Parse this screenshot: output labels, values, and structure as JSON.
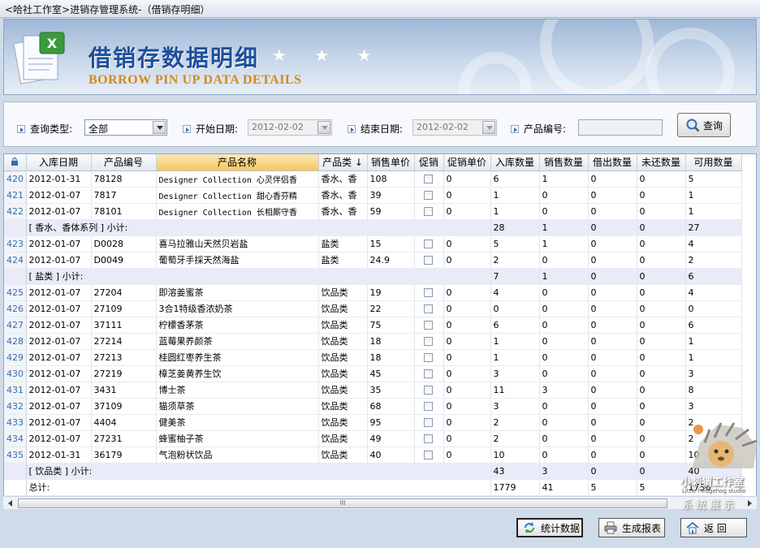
{
  "window": {
    "title": "<哈社工作室>进销存管理系统-（借销存明细）"
  },
  "banner": {
    "title_cn": "借销存数据明细",
    "stars": "★ ★ ★",
    "title_en": "BORROW PIN UP DATA DETAILS"
  },
  "filters": {
    "query_type_label": "查询类型:",
    "query_type_value": "全部",
    "start_date_label": "开始日期:",
    "start_date_value": "2012-02-02",
    "end_date_label": "结束日期:",
    "end_date_value": "2012-02-02",
    "product_code_label": "产品编号:",
    "product_code_value": "",
    "query_button": "查询"
  },
  "table": {
    "columns": [
      "入库日期",
      "产品编号",
      "产品名称",
      "产品类 ↓",
      "销售单价",
      "促销",
      "促销单价",
      "入库数量",
      "销售数量",
      "借出数量",
      "未还数量",
      "可用数量"
    ],
    "rows": [
      {
        "type": "data",
        "n": "420",
        "date": "2012-01-31",
        "code": "78128",
        "name": "Designer Collection 心灵伴侣香",
        "cat": "香水、香",
        "price": "108",
        "pp": "0",
        "in": "6",
        "sale": "1",
        "lend": "0",
        "unret": "0",
        "avail": "5",
        "mono": true
      },
      {
        "type": "data",
        "n": "421",
        "date": "2012-01-07",
        "code": "7817",
        "name": "Designer Collection 甜心香芬精",
        "cat": "香水、香",
        "price": "39",
        "pp": "0",
        "in": "1",
        "sale": "0",
        "lend": "0",
        "unret": "0",
        "avail": "1",
        "mono": true
      },
      {
        "type": "data",
        "n": "422",
        "date": "2012-01-07",
        "code": "78101",
        "name": "Designer Collection 长相厮守香",
        "cat": "香水、香",
        "price": "59",
        "pp": "0",
        "in": "1",
        "sale": "0",
        "lend": "0",
        "unret": "0",
        "avail": "1",
        "mono": true
      },
      {
        "type": "sub",
        "label": "[ 香水、香体系列 ] 小计:",
        "in": "28",
        "sale": "1",
        "lend": "0",
        "unret": "0",
        "avail": "27"
      },
      {
        "type": "data",
        "n": "423",
        "date": "2012-01-07",
        "code": "D0028",
        "name": "喜马拉雅山天然贝岩盐",
        "cat": "盐类",
        "price": "15",
        "pp": "0",
        "in": "5",
        "sale": "1",
        "lend": "0",
        "unret": "0",
        "avail": "4"
      },
      {
        "type": "data",
        "n": "424",
        "date": "2012-01-07",
        "code": "D0049",
        "name": "葡萄牙手採天然海盐",
        "cat": "盐类",
        "price": "24.9",
        "pp": "0",
        "in": "2",
        "sale": "0",
        "lend": "0",
        "unret": "0",
        "avail": "2"
      },
      {
        "type": "sub",
        "label": "[ 盐类 ] 小计:",
        "in": "7",
        "sale": "1",
        "lend": "0",
        "unret": "0",
        "avail": "6"
      },
      {
        "type": "data",
        "n": "425",
        "date": "2012-01-07",
        "code": "27204",
        "name": "即溶姜蜜茶",
        "cat": "饮品类",
        "price": "19",
        "pp": "0",
        "in": "4",
        "sale": "0",
        "lend": "0",
        "unret": "0",
        "avail": "4"
      },
      {
        "type": "data",
        "n": "426",
        "date": "2012-01-07",
        "code": "27109",
        "name": "3合1特级香浓奶茶",
        "cat": "饮品类",
        "price": "22",
        "pp": "0",
        "in": "0",
        "sale": "0",
        "lend": "0",
        "unret": "0",
        "avail": "0"
      },
      {
        "type": "data",
        "n": "427",
        "date": "2012-01-07",
        "code": "37111",
        "name": "柠檬香茅茶",
        "cat": "饮品类",
        "price": "75",
        "pp": "0",
        "in": "6",
        "sale": "0",
        "lend": "0",
        "unret": "0",
        "avail": "6"
      },
      {
        "type": "data",
        "n": "428",
        "date": "2012-01-07",
        "code": "27214",
        "name": "蓝莓果养颜茶",
        "cat": "饮品类",
        "price": "18",
        "pp": "0",
        "in": "1",
        "sale": "0",
        "lend": "0",
        "unret": "0",
        "avail": "1"
      },
      {
        "type": "data",
        "n": "429",
        "date": "2012-01-07",
        "code": "27213",
        "name": "桂圆红枣养生茶",
        "cat": "饮品类",
        "price": "18",
        "pp": "0",
        "in": "1",
        "sale": "0",
        "lend": "0",
        "unret": "0",
        "avail": "1"
      },
      {
        "type": "data",
        "n": "430",
        "date": "2012-01-07",
        "code": "27219",
        "name": "樟芝姜黄养生饮",
        "cat": "饮品类",
        "price": "45",
        "pp": "0",
        "in": "3",
        "sale": "0",
        "lend": "0",
        "unret": "0",
        "avail": "3"
      },
      {
        "type": "data",
        "n": "431",
        "date": "2012-01-07",
        "code": "3431",
        "name": "博士茶",
        "cat": "饮品类",
        "price": "35",
        "pp": "0",
        "in": "11",
        "sale": "3",
        "lend": "0",
        "unret": "0",
        "avail": "8"
      },
      {
        "type": "data",
        "n": "432",
        "date": "2012-01-07",
        "code": "37109",
        "name": "猫须草茶",
        "cat": "饮品类",
        "price": "68",
        "pp": "0",
        "in": "3",
        "sale": "0",
        "lend": "0",
        "unret": "0",
        "avail": "3"
      },
      {
        "type": "data",
        "n": "433",
        "date": "2012-01-07",
        "code": "4404",
        "name": "健美茶",
        "cat": "饮品类",
        "price": "95",
        "pp": "0",
        "in": "2",
        "sale": "0",
        "lend": "0",
        "unret": "0",
        "avail": "2"
      },
      {
        "type": "data",
        "n": "434",
        "date": "2012-01-07",
        "code": "27231",
        "name": "蜂蜜柚子茶",
        "cat": "饮品类",
        "price": "49",
        "pp": "0",
        "in": "2",
        "sale": "0",
        "lend": "0",
        "unret": "0",
        "avail": "2"
      },
      {
        "type": "data",
        "n": "435",
        "date": "2012-01-31",
        "code": "36179",
        "name": "气泡粉状饮品",
        "cat": "饮品类",
        "price": "40",
        "pp": "0",
        "in": "10",
        "sale": "0",
        "lend": "0",
        "unret": "0",
        "avail": "10"
      },
      {
        "type": "sub",
        "label": "[ 饮品类 ] 小计:",
        "in": "43",
        "sale": "3",
        "lend": "0",
        "unret": "0",
        "avail": "40"
      },
      {
        "type": "total",
        "label": "总计:",
        "in": "1779",
        "sale": "41",
        "lend": "5",
        "unret": "5",
        "avail": "1736"
      }
    ]
  },
  "scroll": {
    "grip": "III"
  },
  "buttons": {
    "stats": "统计数据",
    "report": "生成报表",
    "back": "返  回"
  },
  "watermark": {
    "line1": "小刺猬工作室",
    "line2": "Little hedgehog studio",
    "line3": "系统展示"
  },
  "colors": {
    "accent": "#3a6db0",
    "subtotal_row": "#e9ecf8",
    "selected_header": "#f6c65e"
  }
}
